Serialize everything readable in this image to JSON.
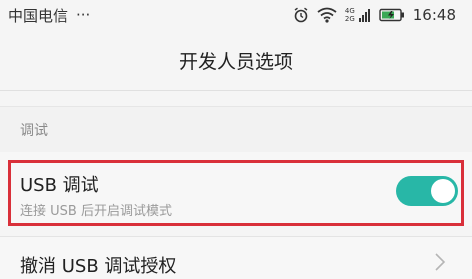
{
  "status_bar": {
    "carrier": "中国电信",
    "more": "···",
    "net_4g": "4G",
    "net_2g": "2G",
    "time": "16:48"
  },
  "header": {
    "title": "开发人员选项"
  },
  "section": {
    "label": "调试"
  },
  "usb_debugging": {
    "title": "USB 调试",
    "subtitle": "连接 USB 后开启调试模式",
    "enabled": true
  },
  "revoke": {
    "label": "撤消 USB 调试授权"
  },
  "colors": {
    "toggle_on": "#28b7a7",
    "highlight": "#d9303a"
  }
}
